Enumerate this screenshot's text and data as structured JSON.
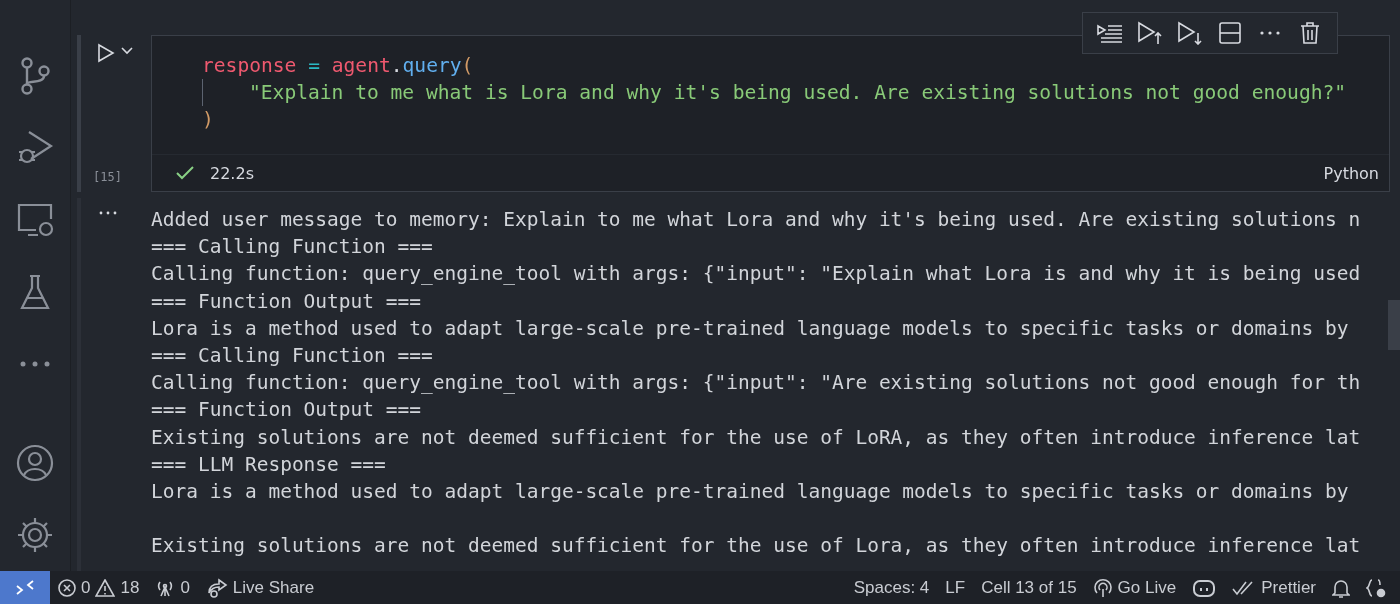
{
  "cell": {
    "run_count": "[15]",
    "duration": "22.2s",
    "succeeded": true,
    "language": "Python",
    "code": [
      {
        "indented": false,
        "tokens": [
          {
            "kind": "var",
            "s": "response"
          },
          {
            "kind": "op",
            "s": " = "
          },
          {
            "kind": "var",
            "s": "agent"
          },
          {
            "kind": "plain",
            "s": "."
          },
          {
            "kind": "fn",
            "s": "query"
          },
          {
            "kind": "paren",
            "s": "("
          }
        ]
      },
      {
        "indented": true,
        "tokens": [
          {
            "kind": "str",
            "s": "\"Explain to me what is Lora and why it's being used. Are existing solutions not good enough?\""
          }
        ]
      },
      {
        "indented": false,
        "tokens": [
          {
            "kind": "paren",
            "s": ")"
          }
        ]
      }
    ]
  },
  "output": {
    "blocks": [
      [
        "Added user message to memory: Explain to me what Lora and why it's being used. Are existing solutions n",
        "=== Calling Function ===",
        "Calling function: query_engine_tool with args: {\"input\": \"Explain what Lora is and why it is being used",
        "=== Function Output ===",
        "Lora is a method used to adapt large-scale pre-trained language models to specific tasks or domains by",
        "=== Calling Function ===",
        "Calling function: query_engine_tool with args: {\"input\": \"Are existing solutions not good enough for th",
        "=== Function Output ===",
        "Existing solutions are not deemed sufficient for the use of LoRA, as they often introduce inference lat",
        "=== LLM Response ===",
        "Lora is a method used to adapt large-scale pre-trained language models to specific tasks or domains by"
      ],
      [
        "Existing solutions are not deemed sufficient for the use of Lora, as they often introduce inference lat"
      ]
    ]
  },
  "status_bar": {
    "errors": "0",
    "warnings": "18",
    "ports": "0",
    "live_share": "Live Share",
    "spaces": "Spaces: 4",
    "eol": "LF",
    "cell_position": "Cell 13 of 15",
    "go_live": "Go Live",
    "prettier": "Prettier"
  }
}
